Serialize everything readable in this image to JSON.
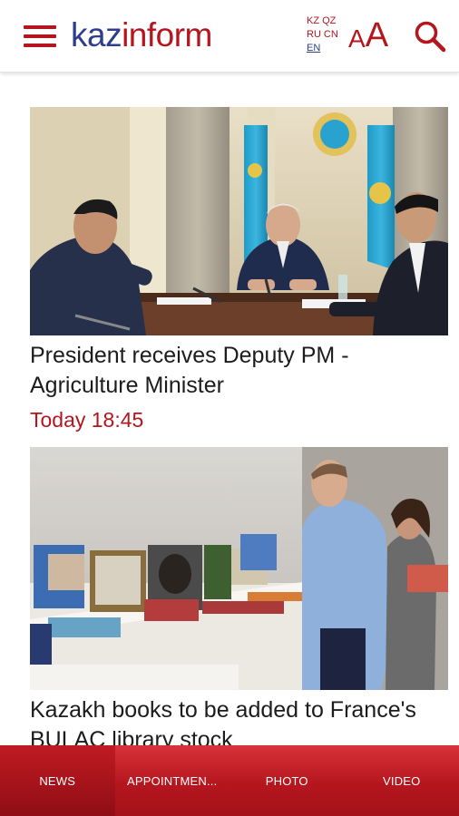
{
  "header": {
    "logo_part1": "kaz",
    "logo_part2": "inform",
    "languages": [
      [
        "KZ",
        "QZ"
      ],
      [
        "RU",
        "CN"
      ],
      [
        "EN"
      ]
    ],
    "active_language": "EN",
    "font_size_small": "A",
    "font_size_big": "A"
  },
  "articles": [
    {
      "title": "President receives Deputy PM - Agriculture Minister",
      "time": "Today 18:45"
    },
    {
      "title": "Kazakh books to be added to France's BULAC library stock",
      "time": ""
    }
  ],
  "tabs": [
    {
      "label": "News",
      "active": true
    },
    {
      "label": "Appointmen...",
      "active": false
    },
    {
      "label": "Photo",
      "active": false
    },
    {
      "label": "Video",
      "active": false
    }
  ],
  "colors": {
    "brand_red": "#b5161e",
    "brand_blue": "#2e3e8c"
  }
}
